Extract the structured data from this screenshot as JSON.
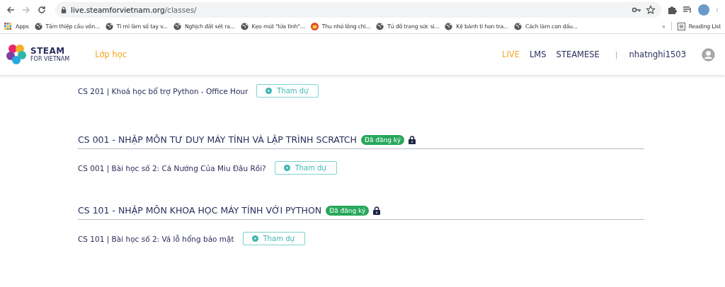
{
  "browser": {
    "url_host": "live.steamforvietnam.org",
    "url_path": "/classes/",
    "bookmarks": [
      {
        "label": "Apps",
        "kind": "apps"
      },
      {
        "label": "Tấm thiệp cầu vồn...",
        "kind": "globe"
      },
      {
        "label": "Tí mì làm sổ tay v...",
        "kind": "globe"
      },
      {
        "label": "Nghịch đất sét ra...",
        "kind": "globe"
      },
      {
        "label": "Kẹo mút \"lửa tình\"...",
        "kind": "globe"
      },
      {
        "label": "Thu nhỏ lồng chi...",
        "kind": "site"
      },
      {
        "label": "Tủ đồ trang sức si...",
        "kind": "globe"
      },
      {
        "label": "Kệ bánh tí hon tra...",
        "kind": "globe"
      },
      {
        "label": "Cách làm con dấu...",
        "kind": "globe"
      }
    ],
    "more": "»",
    "reading_list": "Reading List"
  },
  "header": {
    "logo_title": "STEAM",
    "logo_subtitle": "FOR VIETNAM",
    "section_link": "Lớp học",
    "nav": [
      {
        "label": "LIVE",
        "selected": true
      },
      {
        "label": "LMS",
        "selected": false
      },
      {
        "label": "STEAMESE",
        "selected": false
      }
    ],
    "separator": "|",
    "username": "nhatnghi1503"
  },
  "sections": [
    {
      "lessons": [
        {
          "title": "CS 201 | Khoá học bổ trợ Python - Office Hour",
          "action": "Tham dự"
        }
      ]
    },
    {
      "title": "CS 001 - NHẬP MÔN TƯ DUY MÁY TÍNH VÀ LẬP TRÌNH SCRATCH",
      "badge": "Đã đăng ký",
      "locked": true,
      "lessons": [
        {
          "title": "CS 001 | Bài học số 2: Cá Nướng Của Miu Đâu Rồi?",
          "action": "Tham dự"
        }
      ]
    },
    {
      "title": "CS 101 - NHẬP MÔN KHOA HỌC MÁY TÍNH VỚI PYTHON",
      "badge": "Đã đăng ký",
      "locked": true,
      "lessons": [
        {
          "title": "CS 101 | Bài học số 2: Vá lỗ hổng bảo mật",
          "action": "Tham dự"
        }
      ]
    }
  ]
}
